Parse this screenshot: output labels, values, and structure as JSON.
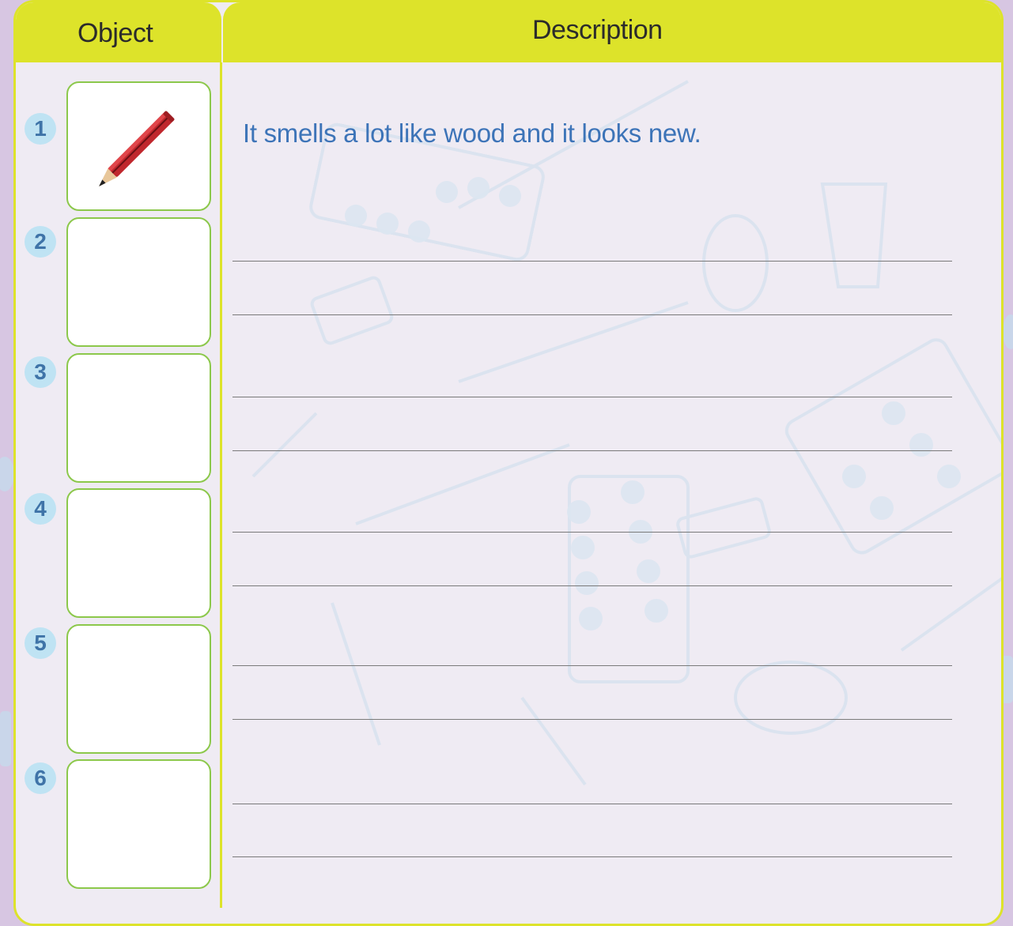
{
  "header": {
    "object_label": "Object",
    "description_label": "Description"
  },
  "rows": [
    {
      "number": "1",
      "object_icon": "pencil-icon",
      "description": "It smells a lot like wood and it looks new."
    },
    {
      "number": "2",
      "object_icon": "",
      "description": ""
    },
    {
      "number": "3",
      "object_icon": "",
      "description": ""
    },
    {
      "number": "4",
      "object_icon": "",
      "description": ""
    },
    {
      "number": "5",
      "object_icon": "",
      "description": ""
    },
    {
      "number": "6",
      "object_icon": "",
      "description": ""
    }
  ],
  "colors": {
    "header": "#dde32a",
    "number_badge": "#bfe3f3",
    "number_text": "#3f74a8",
    "description_text": "#3d74b8",
    "box_border": "#8cc84b"
  }
}
